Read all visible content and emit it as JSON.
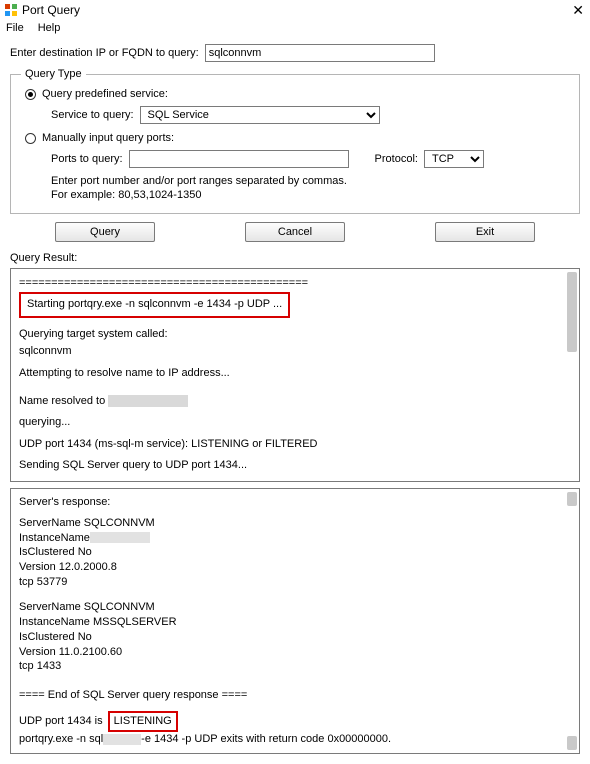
{
  "window": {
    "title": "Port Query",
    "close_glyph": "✕"
  },
  "menu": {
    "file": "File",
    "help": "Help"
  },
  "dest": {
    "label": "Enter destination IP or FQDN to query:",
    "value": "sqlconnvm"
  },
  "querytype": {
    "legend": "Query Type",
    "predefined_label": "Query predefined service:",
    "service_label": "Service to query:",
    "service_value": "SQL Service",
    "manual_label": "Manually input query ports:",
    "ports_label": "Ports to query:",
    "ports_value": "",
    "protocol_label": "Protocol:",
    "protocol_value": "TCP",
    "hint_line1": "Enter port number and/or port ranges separated by commas.",
    "hint_line2": "For example: 80,53,1024-1350"
  },
  "buttons": {
    "query": "Query",
    "cancel": "Cancel",
    "exit": "Exit"
  },
  "result": {
    "label": "Query Result:",
    "rule": "=============================================",
    "starting": "Starting portqry.exe -n sqlconnvm -e 1434 -p UDP ...",
    "querying_target": "Querying target system called:",
    "target_name": "sqlconnvm",
    "resolving": "Attempting to resolve name to IP address...",
    "resolved_prefix": "Name resolved to",
    "querying": "querying...",
    "udp_listen_or_filtered": "UDP port 1434 (ms-sql-m service): LISTENING or FILTERED",
    "sending": "Sending SQL Server query to UDP port 1434..."
  },
  "response": {
    "header": "Server's response:",
    "s1_name": "ServerName SQLCONNVM",
    "s1_inst_prefix": "InstanceName",
    "s1_clustered": "IsClustered No",
    "s1_version": "Version 12.0.2000.8",
    "s1_tcp": "tcp 53779",
    "s2_name": "ServerName SQLCONNVM",
    "s2_inst": "InstanceName MSSQLSERVER",
    "s2_clustered": "IsClustered No",
    "s2_version": "Version 11.0.2100.60",
    "s2_tcp": "tcp 1433",
    "end_rule": "==== End of SQL Server query response ====",
    "udp_prefix": "UDP port 1434 is",
    "udp_status": "LISTENING",
    "exit_line_pre": "portqry.exe -n sql",
    "exit_line_post": "-e 1434 -p UDP exits with return code 0x00000000."
  }
}
